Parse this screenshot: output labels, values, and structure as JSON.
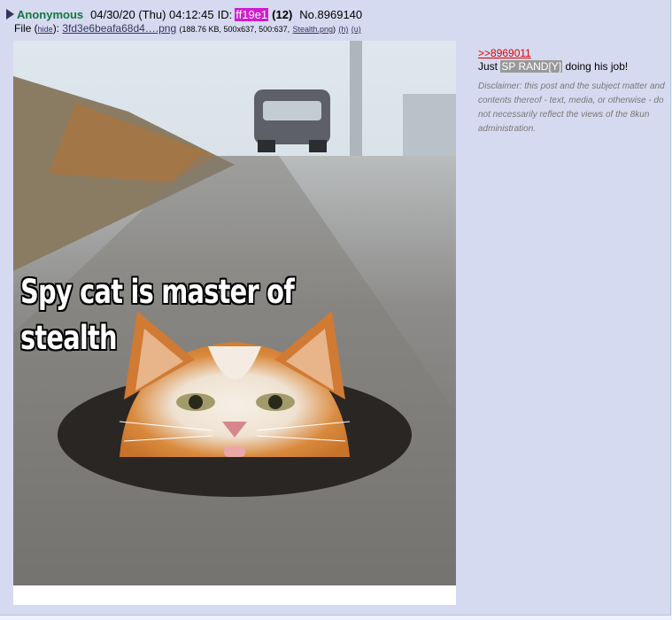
{
  "post": {
    "name": "Anonymous",
    "date": "04/30/20 (Thu) 04:12:45",
    "id_label": "ID:",
    "id": "ff19e1",
    "reply_count": "(12)",
    "post_number": "No.8969140",
    "colors": {
      "name": "#117743",
      "id_bg": "#d11bd2",
      "post_bg": "#d6daf0"
    }
  },
  "file": {
    "label": "File (",
    "hide": "hide",
    "label_close": "):",
    "filename": "3fd3e6beafa68d4….png",
    "details": "(188.76 KB, 500x637, 500:637,",
    "original_name": "Stealth.png",
    "close_paren": ")",
    "h_link": "(h)",
    "u_link": "(u)"
  },
  "image": {
    "caption_line1": "Spy cat is master of",
    "caption_line2": "stealth"
  },
  "body": {
    "quote_link": ">>8969011",
    "text_before": "Just ",
    "spoiler": "SP RAND[Y]",
    "text_after": " doing his job!",
    "disclaimer": "Disclaimer: this post and the subject matter and contents thereof - text, media, or otherwise - do not necessarily reflect the views of the 8kun administration."
  }
}
